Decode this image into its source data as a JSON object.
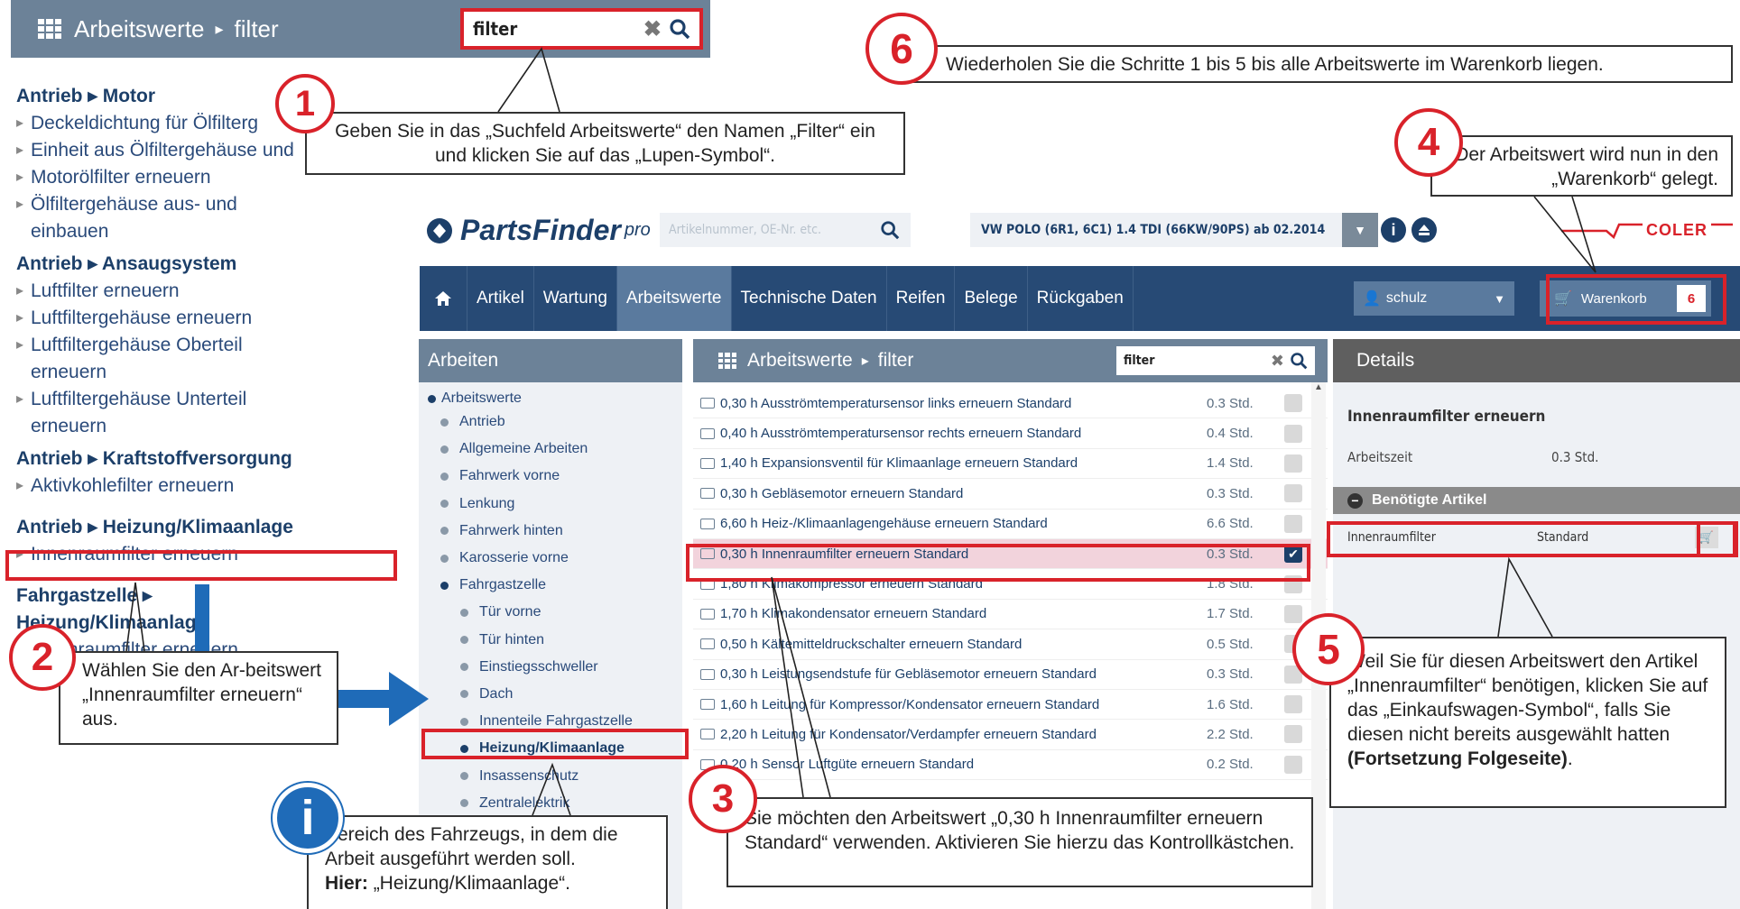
{
  "snippet": {
    "title": "Arbeitswerte",
    "sep": "▸",
    "crumb": "filter",
    "search_value": "filter"
  },
  "left_list": [
    {
      "head": "Antrieb ▸ Motor",
      "items": [
        "Deckeldichtung für Ölfilterg",
        "Einheit aus Ölfiltergehäuse und",
        "Motorölfilter erneuern",
        "Ölfiltergehäuse aus- und einbauen"
      ]
    },
    {
      "head": "Antrieb ▸ Ansaugsystem",
      "items": [
        "Luftfilter erneuern",
        "Luftfiltergehäuse erneuern",
        "Luftfiltergehäuse Oberteil erneuern",
        "Luftfiltergehäuse Unterteil erneuern"
      ]
    },
    {
      "head": "Antrieb ▸ Kraftstoffversorgung",
      "items": [
        "Aktivkohlefilter erneuern"
      ]
    },
    {
      "head": "Antrieb ▸ Heizung/Klimaanlage",
      "items": [
        "Innenraumfilter erneuern"
      ]
    },
    {
      "head": "Fahrgastzelle ▸ Heizung/Klimaanlage",
      "items": [
        "Innenraumfilter erneuern"
      ]
    }
  ],
  "callouts": {
    "c1": "Geben Sie in das „Suchfeld Arbeitswerte“ den Namen „Filter“ ein und klicken Sie auf das „Lupen-Symbol“.",
    "c2": "Wählen Sie den Ar-beitswert „Innenraumfilter erneuern“ aus.",
    "c3": "Sie möchten den Arbeitswert „0,30 h Innenraumfilter erneuern Standard“ verwenden. Aktivieren Sie hierzu das Kontrollkästchen.",
    "c4": "Der Arbeitswert wird nun in den „Warenkorb“ gelegt.",
    "c5a": "Weil Sie für diesen Arbeitswert den Artikel „Innenraumfilter“ benötigen, klicken Sie auf das „Einkaufswagen-Symbol“, falls Sie diesen nicht bereits ausgewählt hatten ",
    "c5b": "(Fortsetzung Folgeseite)",
    "c5c": ".",
    "c6": "Wiederholen Sie die Schritte 1 bis 5 bis alle Arbeitswerte im Warenkorb liegen.",
    "info_a": "Bereich des Fahrzeugs, in dem die Arbeit ausgeführt werden soll.",
    "info_b": "Hier:",
    "info_c": " „Heizung/Klimaanlage“."
  },
  "badges": {
    "b1": "1",
    "b2": "2",
    "b3": "3",
    "b4": "4",
    "b5": "5",
    "b6": "6",
    "info": "i"
  },
  "app": {
    "logo": "PartsFinder",
    "logo_sup": "pro",
    "search_placeholder": "Artikelnummer, OE-Nr. etc.",
    "vehicle": "VW POLO (6R1, 6C1) 1.4 TDI (66KW/90PS) ab 02.2014",
    "brand": "COLER",
    "nav": [
      "Artikel",
      "Wartung",
      "Arbeitswerte",
      "Technische Daten",
      "Reifen",
      "Belege",
      "Rückgaben"
    ],
    "user": "schulz",
    "cart_label": "Warenkorb",
    "cart_count": "6",
    "arbeiten_title": "Arbeiten",
    "tree": [
      {
        "label": "Arbeitswerte",
        "lvl": 0,
        "dk": true
      },
      {
        "label": "Antrieb",
        "lvl": 1
      },
      {
        "label": "Allgemeine Arbeiten",
        "lvl": 1
      },
      {
        "label": "Fahrwerk vorne",
        "lvl": 1
      },
      {
        "label": "Lenkung",
        "lvl": 1
      },
      {
        "label": "Fahrwerk hinten",
        "lvl": 1
      },
      {
        "label": "Karosserie vorne",
        "lvl": 1
      },
      {
        "label": "Fahrgastzelle",
        "lvl": 1,
        "dk": true
      },
      {
        "label": "Tür vorne",
        "lvl": 2
      },
      {
        "label": "Tür hinten",
        "lvl": 2
      },
      {
        "label": "Einstiegsschweller",
        "lvl": 2
      },
      {
        "label": "Dach",
        "lvl": 2
      },
      {
        "label": "Innenteile Fahrgastzelle",
        "lvl": 2
      },
      {
        "label": "Heizung/Klimaanlage",
        "lvl": 2,
        "dk": true,
        "bold": true
      },
      {
        "label": "Insassenschutz",
        "lvl": 2
      },
      {
        "label": "Zentralelektrik",
        "lvl": 2
      }
    ],
    "mid_title": "Arbeitswerte",
    "mid_crumb": "filter",
    "mid_search": "filter",
    "rows": [
      {
        "label": "0,30 h Ausströmtemperatursensor links erneuern Standard",
        "hrs": "0.3 Std."
      },
      {
        "label": "0,40 h Ausströmtemperatursensor rechts erneuern Standard",
        "hrs": "0.4 Std."
      },
      {
        "label": "1,40 h Expansionsventil für Klimaanlage erneuern Standard",
        "hrs": "1.4 Std."
      },
      {
        "label": "0,30 h Gebläsemotor erneuern Standard",
        "hrs": "0.3 Std."
      },
      {
        "label": "6,60 h Heiz-/Klimaanlagengehäuse erneuern Standard",
        "hrs": "6.6 Std."
      },
      {
        "label": "0,30 h Innenraumfilter erneuern Standard",
        "hrs": "0.3 Std.",
        "sel": true
      },
      {
        "label": "1,80 h Klimakompressor erneuern Standard",
        "hrs": "1.8 Std."
      },
      {
        "label": "1,70 h Klimakondensator erneuern Standard",
        "hrs": "1.7 Std."
      },
      {
        "label": "0,50 h Kältemitteldruckschalter erneuern Standard",
        "hrs": "0.5 Std."
      },
      {
        "label": "0,30 h Leistungsendstufe für Gebläsemotor erneuern Standard",
        "hrs": "0.3 Std."
      },
      {
        "label": "1,60 h Leitung für Kompressor/Kondensator erneuern Standard",
        "hrs": "1.6 Std."
      },
      {
        "label": "2,20 h Leitung für Kondensator/Verdampfer erneuern Standard",
        "hrs": "2.2 Std."
      },
      {
        "label": "0,20 h Sensor Luftgüte erneuern Standard",
        "hrs": "0.2 Std."
      }
    ],
    "details_title": "Details",
    "details_name": "Innenraumfilter erneuern",
    "arbeitszeit_label": "Arbeitszeit",
    "arbeitszeit_value": "0.3 Std.",
    "needed_title": "Benötigte Artikel",
    "needed_item": "Innenraumfilter",
    "needed_variant": "Standard"
  },
  "colors": {
    "accent_red": "#d9222a",
    "nav_blue": "#274a75",
    "panel_gray": "#6c8298",
    "arrow_blue": "#1f6bb8"
  }
}
